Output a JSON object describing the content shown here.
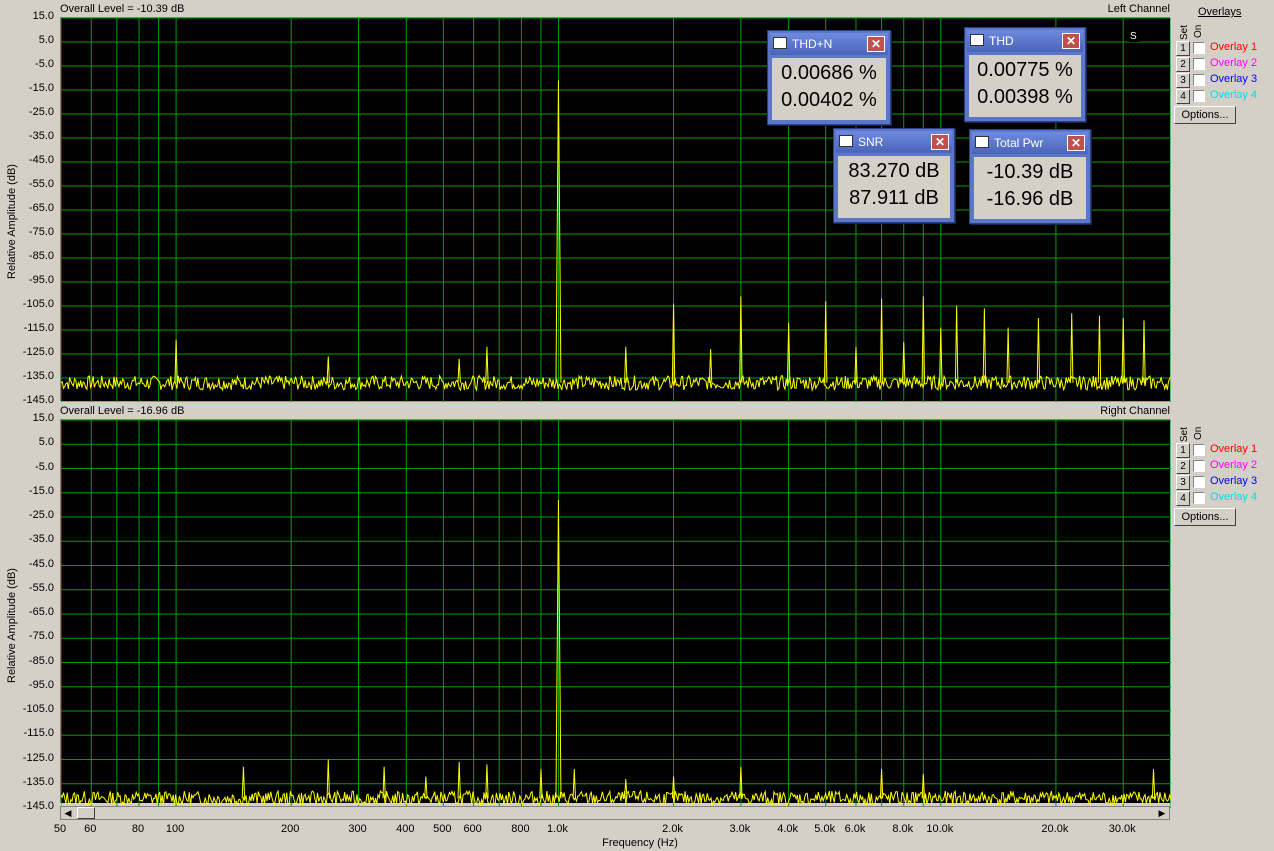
{
  "overlays": {
    "title": "Overlays",
    "set_label": "Set",
    "on_label": "On",
    "items": [
      {
        "num": "1",
        "label": "Overlay 1",
        "color": "#ff0000"
      },
      {
        "num": "2",
        "label": "Overlay 2",
        "color": "#ff00ff"
      },
      {
        "num": "3",
        "label": "Overlay 3",
        "color": "#0000ff"
      },
      {
        "num": "4",
        "label": "Overlay 4",
        "color": "#00e0e0"
      }
    ],
    "options_label": "Options..."
  },
  "meters": {
    "thdn": {
      "title": "THD+N",
      "v1": "0.00686 %",
      "v2": "0.00402 %"
    },
    "thd": {
      "title": "THD",
      "v1": "0.00775 %",
      "v2": "0.00398 %"
    },
    "snr": {
      "title": "SNR",
      "v1": "83.270 dB",
      "v2": "87.911 dB"
    },
    "pwr": {
      "title": "Total Pwr",
      "v1": "-10.39 dB",
      "v2": "-16.96 dB"
    }
  },
  "top": {
    "level": "Overall Level = -10.39 dB",
    "channel": "Left Channel"
  },
  "bottom": {
    "level": "Overall Level = -16.96 dB",
    "channel": "Right Channel"
  },
  "chart_data": [
    {
      "type": "line",
      "title": "Left Channel",
      "subtitle": "Overall Level = -10.39 dB",
      "xlabel": "",
      "ylabel": "Relative Amplitude (dB)",
      "xscale": "log",
      "xlim": [
        50,
        40000
      ],
      "ylim": [
        -145,
        15
      ],
      "grid": true,
      "trace_color": "#ffff00",
      "yticks": [
        "15.0",
        "5.0",
        "-5.0",
        "-15.0",
        "-25.0",
        "-35.0",
        "-45.0",
        "-55.0",
        "-65.0",
        "-75.0",
        "-85.0",
        "-95.0",
        "-105.0",
        "-115.0",
        "-125.0",
        "-135.0",
        "-145.0"
      ],
      "noise_floor_db": -137,
      "peaks": [
        {
          "freq": 100,
          "db": -119
        },
        {
          "freq": 250,
          "db": -126
        },
        {
          "freq": 550,
          "db": -127
        },
        {
          "freq": 650,
          "db": -122
        },
        {
          "freq": 1000,
          "db": -11
        },
        {
          "freq": 1500,
          "db": -122
        },
        {
          "freq": 2000,
          "db": -104
        },
        {
          "freq": 2500,
          "db": -123
        },
        {
          "freq": 3000,
          "db": -101
        },
        {
          "freq": 4000,
          "db": -112
        },
        {
          "freq": 5000,
          "db": -103
        },
        {
          "freq": 6000,
          "db": -122
        },
        {
          "freq": 7000,
          "db": -102
        },
        {
          "freq": 8000,
          "db": -120
        },
        {
          "freq": 9000,
          "db": -101
        },
        {
          "freq": 10000,
          "db": -114
        },
        {
          "freq": 11000,
          "db": -105
        },
        {
          "freq": 13000,
          "db": -106
        },
        {
          "freq": 15000,
          "db": -114
        },
        {
          "freq": 18000,
          "db": -110
        },
        {
          "freq": 22000,
          "db": -108
        },
        {
          "freq": 26000,
          "db": -109
        },
        {
          "freq": 30000,
          "db": -110
        },
        {
          "freq": 34000,
          "db": -111
        }
      ]
    },
    {
      "type": "line",
      "title": "Right Channel",
      "subtitle": "Overall Level = -16.96 dB",
      "xlabel": "Frequency (Hz)",
      "ylabel": "Relative Amplitude (dB)",
      "xscale": "log",
      "xlim": [
        50,
        40000
      ],
      "ylim": [
        -145,
        15
      ],
      "grid": true,
      "trace_color": "#ffff00",
      "yticks": [
        "15.0",
        "5.0",
        "-5.0",
        "-15.0",
        "-25.0",
        "-35.0",
        "-45.0",
        "-55.0",
        "-65.0",
        "-75.0",
        "-85.0",
        "-95.0",
        "-105.0",
        "-115.0",
        "-125.0",
        "-135.0",
        "-145.0"
      ],
      "xticks": [
        "50",
        "60",
        "80",
        "100",
        "200",
        "300",
        "400",
        "500",
        "600",
        "800",
        "1.0k",
        "2.0k",
        "3.0k",
        "4.0k",
        "5.0k",
        "6.0k",
        "8.0k",
        "10.0k",
        "20.0k",
        "30.0k"
      ],
      "xtick_values": [
        50,
        60,
        80,
        100,
        200,
        300,
        400,
        500,
        600,
        800,
        1000,
        2000,
        3000,
        4000,
        5000,
        6000,
        8000,
        10000,
        20000,
        30000
      ],
      "noise_floor_db": -141,
      "peaks": [
        {
          "freq": 150,
          "db": -128
        },
        {
          "freq": 250,
          "db": -125
        },
        {
          "freq": 350,
          "db": -128
        },
        {
          "freq": 450,
          "db": -132
        },
        {
          "freq": 550,
          "db": -126
        },
        {
          "freq": 650,
          "db": -127
        },
        {
          "freq": 900,
          "db": -129
        },
        {
          "freq": 1000,
          "db": -18
        },
        {
          "freq": 1100,
          "db": -129
        },
        {
          "freq": 1500,
          "db": -133
        },
        {
          "freq": 2000,
          "db": -132
        },
        {
          "freq": 3000,
          "db": -128
        },
        {
          "freq": 7000,
          "db": -129
        },
        {
          "freq": 9000,
          "db": -131
        },
        {
          "freq": 36000,
          "db": -129
        }
      ]
    }
  ]
}
